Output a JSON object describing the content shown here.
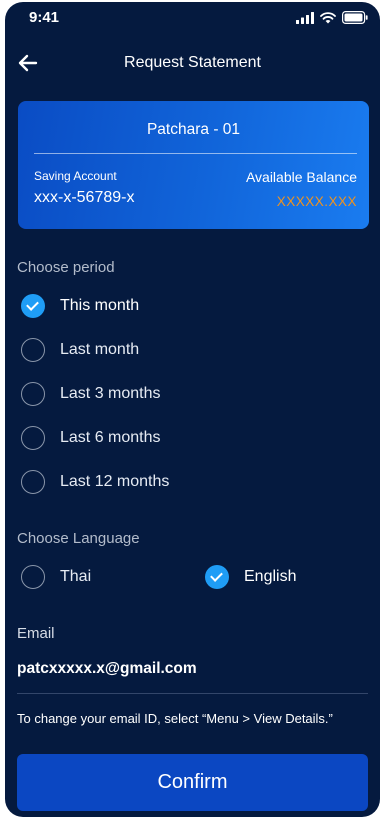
{
  "status_bar": {
    "time": "9:41"
  },
  "header": {
    "title": "Request Statement"
  },
  "account_card": {
    "name": "Patchara - 01",
    "account_type": "Saving Account",
    "account_number": "xxx-x-56789-x",
    "balance_label": "Available Balance",
    "balance_value": "XXXXX.XXX"
  },
  "period": {
    "label": "Choose period",
    "options": [
      {
        "label": "This month",
        "selected": true
      },
      {
        "label": "Last month",
        "selected": false
      },
      {
        "label": "Last 3 months",
        "selected": false
      },
      {
        "label": "Last 6 months",
        "selected": false
      },
      {
        "label": "Last 12 months",
        "selected": false
      }
    ]
  },
  "language": {
    "label": "Choose Language",
    "options": [
      {
        "label": "Thai",
        "selected": false
      },
      {
        "label": "English",
        "selected": true
      }
    ]
  },
  "email": {
    "label": "Email",
    "value": "patcxxxxx.x@gmail.com",
    "note": "To change your email ID, select “Menu > View Details.”"
  },
  "confirm_label": "Confirm",
  "colors": {
    "background": "#051a3f",
    "accent": "#1f9df6",
    "button": "#0b47c2",
    "balance": "#f0931f"
  }
}
